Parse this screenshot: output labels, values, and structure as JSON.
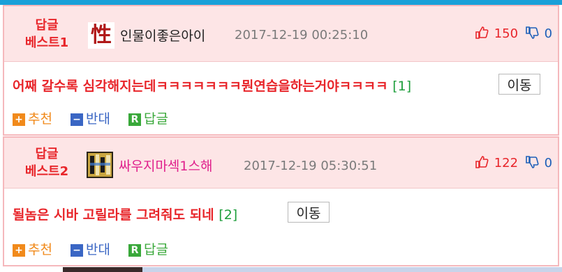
{
  "comments": [
    {
      "best_label": "답글\n베스트1",
      "best_line1": "답글",
      "best_line2": "베스트1",
      "avatar_icon": "sex-hanja-icon",
      "avatar_char": "性",
      "nickname": "인물이좋은아이",
      "timestamp": "2017-12-19 00:25:10",
      "up_votes": "150",
      "down_votes": "0",
      "text": "어째 갈수록 심각해지는데ㅋㅋㅋㅋㅋㅋㅋ뭔연습을하는거야ㅋㅋㅋㅋ",
      "reply_count": "[1]",
      "move_label": "이동",
      "recommend_label": "추천",
      "oppose_label": "반대",
      "reply_label": "답글"
    },
    {
      "best_line1": "답글",
      "best_line2": "베스트2",
      "avatar_icon": "pixel-avatar-icon",
      "nickname": "싸우지마섹1스해",
      "timestamp": "2017-12-19 05:30:51",
      "up_votes": "122",
      "down_votes": "0",
      "text": "될놈은 시바 고릴라를 그려줘도 되네",
      "reply_count": "[2]",
      "move_label": "이동",
      "recommend_label": "추천",
      "oppose_label": "반대",
      "reply_label": "답글"
    }
  ],
  "icons": {
    "recommend": "+",
    "oppose": "−",
    "reply": "R"
  },
  "colors": {
    "accent_red": "#e8252a",
    "header_bg": "#fde5e6",
    "recommend": "#f18a1b",
    "oppose": "#3a66c4",
    "reply": "#39a83a"
  }
}
